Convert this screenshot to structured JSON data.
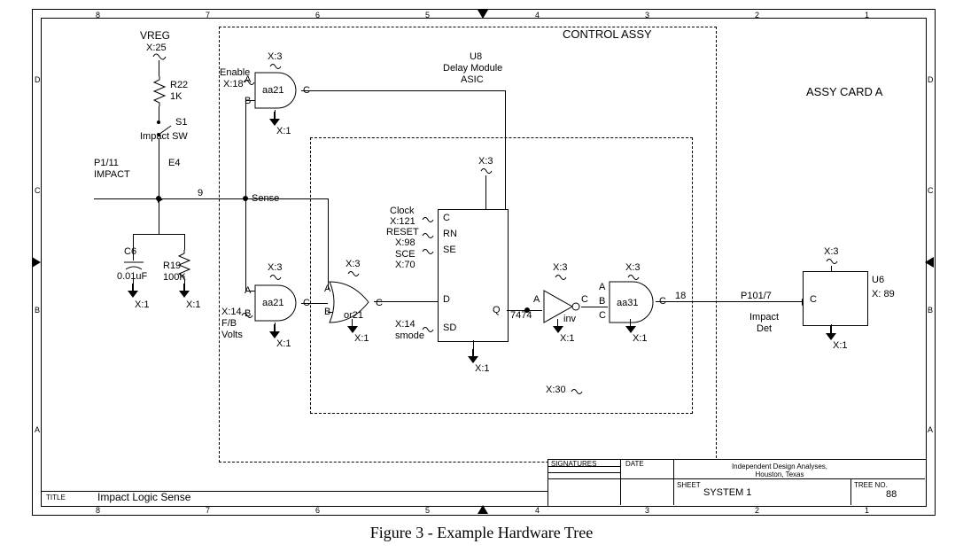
{
  "caption": "Figure 3 - Example Hardware Tree",
  "ruler": {
    "top": [
      "8",
      "7",
      "6",
      "5",
      "4",
      "3",
      "2",
      "1"
    ],
    "bottom": [
      "8",
      "7",
      "6",
      "5",
      "4",
      "3",
      "2",
      "1"
    ],
    "left": [
      "D",
      "C",
      "B",
      "A"
    ],
    "right": [
      "D",
      "C",
      "B",
      "A"
    ]
  },
  "titleblock": {
    "title_lbl": "TITLE",
    "title": "Impact Logic Sense",
    "sheet_lbl": "SHEET",
    "sheet": "SYSTEM 1",
    "treeno_lbl": "TREE NO.",
    "treeno": "88",
    "company": "Independent Design Analyses, Houston, Texas",
    "sig_lbl": "SIGNATURES",
    "date_lbl": "DATE"
  },
  "regions": {
    "control_assy": "CONTROL ASSY",
    "assy_card": "ASSY CARD  A",
    "u8_name": "U8",
    "u8_line2": "Delay Module",
    "u8_line3": "ASIC"
  },
  "left_net": {
    "vreg": "VREG",
    "vreg_x": "X:25",
    "r22": "R22",
    "r22_val": "1K",
    "s1": "S1",
    "s1_desc": "Impact SW",
    "p": "P1/11",
    "p_desc": "IMPACT",
    "e4": "E4",
    "c6": "C6",
    "c6_val": "0.01uF",
    "r19": "R19",
    "r19_val": "100K",
    "x1a": "X:1",
    "x1b": "X:1",
    "node9": "9",
    "sense": "Sense"
  },
  "gate_top": {
    "name": "aa21",
    "enable": "Enable",
    "enable_x": "X:18",
    "a": "A",
    "b": "B",
    "c": "C",
    "top_x": "X:3",
    "bot_x": "X:1"
  },
  "gate_mid": {
    "name": "aa21",
    "a": "A",
    "b": "B",
    "c": "C",
    "fb": "F/B",
    "fb2": "Volts",
    "fb_x": "X:14",
    "top_x": "X:3",
    "bot_x": "X:1"
  },
  "or_gate": {
    "name": "or21",
    "a": "A",
    "b": "B",
    "c": "C",
    "top_x": "X:3",
    "bot_x": "X:1"
  },
  "ff": {
    "type": "7474",
    "d": "D",
    "q": "Q",
    "sd": "SD",
    "c_pin": "C",
    "rn": "RN",
    "se": "SE",
    "clock": "Clock",
    "clock_x": "X:121",
    "reset": "RESET",
    "reset_x": "X:98",
    "sce": "SCE",
    "sce_x": "X:70",
    "smode": "smode",
    "smode_x": "X:14",
    "top_x": "X:3",
    "bot_x": "X:1",
    "bot_alt": "X:30"
  },
  "inv": {
    "name": "inv",
    "a": "A",
    "c": "C",
    "top_x": "X:3",
    "bot_x": "X:1"
  },
  "gate_right": {
    "name": "aa31",
    "a": "A",
    "b": "B",
    "c": "C",
    "c_out": "C",
    "out_node": "18",
    "top_x": "X:3",
    "bot_x": "X:1"
  },
  "u6": {
    "name": "U6",
    "x": "X: 89",
    "c": "C",
    "top_x": "X:3",
    "bot_x": "X:1",
    "p": "P101/7",
    "desc": "Impact",
    "desc2": "Det"
  }
}
